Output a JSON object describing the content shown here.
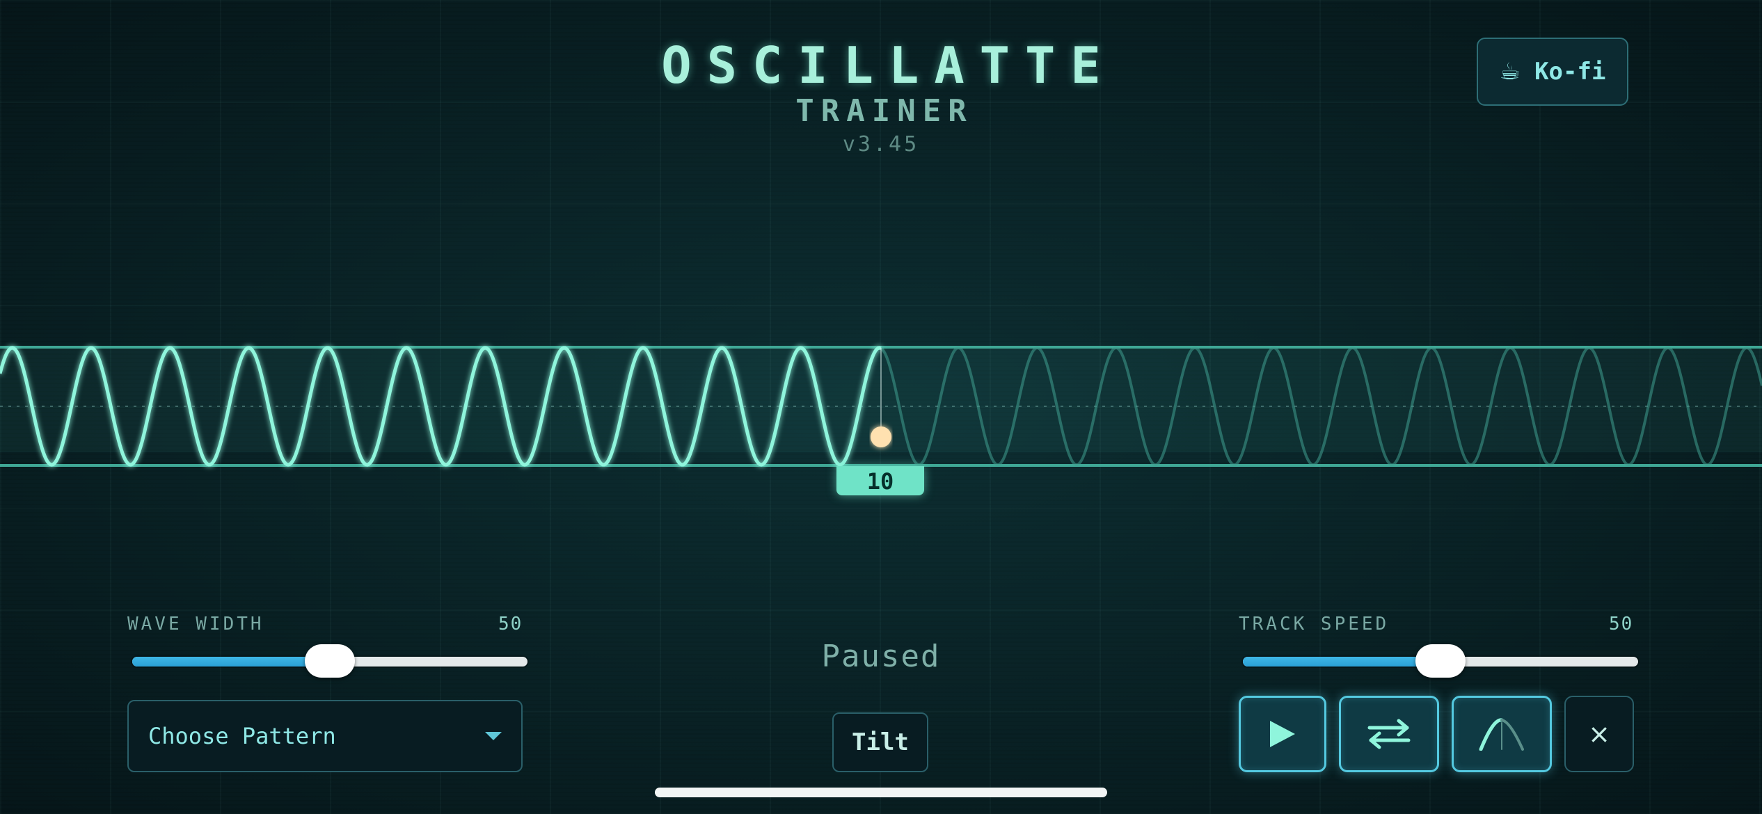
{
  "app": {
    "title": "OSCILLATTE",
    "subtitle": "TRAINER",
    "version": "v3.45"
  },
  "kofi": {
    "icon": "coffee-cup-icon",
    "label": "Ko-fi"
  },
  "scope": {
    "marker_value": "10",
    "wave_color": "#8ff5dc",
    "ghost_wave_color": "#3f9e90",
    "cursor_color": "#ffe1b0"
  },
  "wave_width": {
    "label": "WAVE WIDTH",
    "value": "50",
    "level": 0.5
  },
  "track_speed": {
    "label": "TRACK SPEED",
    "value": "50",
    "level": 0.5
  },
  "pattern_select": {
    "label": "Choose Pattern",
    "icon": "caret-down-icon"
  },
  "status": {
    "text": "Paused"
  },
  "tilt_button": {
    "label": "Tilt"
  },
  "controls": {
    "play": {
      "icon": "play-icon",
      "active": true
    },
    "swap": {
      "icon": "swap-arrows-icon",
      "active": true
    },
    "curve": {
      "icon": "curve-icon",
      "active": true
    },
    "close": {
      "icon": "close-icon",
      "label": "×",
      "active": false
    }
  },
  "colors": {
    "background": "#092227",
    "accent": "#6fe3c7",
    "slider_fill": "#3fb7e6"
  }
}
